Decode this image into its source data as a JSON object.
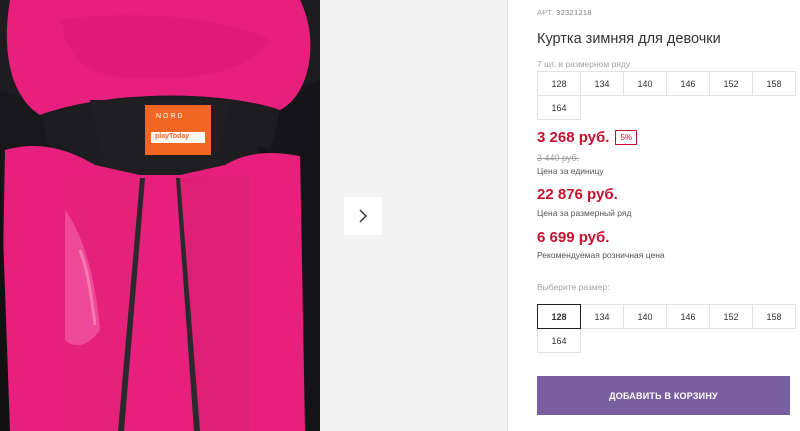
{
  "gallery": {
    "brand_label_top": "NORD",
    "brand_label_logo": "playToday",
    "next_icon": "chevron-right-icon"
  },
  "product": {
    "sku_label": "АРТ.",
    "sku": "32321218",
    "title": "Куртка зимняя для девочки",
    "size_count": "7 шт. в размерном ряду",
    "sizes_row": [
      "128",
      "134",
      "140",
      "146",
      "152",
      "158",
      "164"
    ],
    "price": "3 268 руб.",
    "discount": "5%",
    "old_price": "3 440 руб.",
    "price_note": "Цена за единицу",
    "set_price": "22 876 руб.",
    "set_price_note": "Цена за размерный ряд",
    "retail_price": "6 699 руб.",
    "retail_price_note": "Рекомендуемая розничная цена",
    "choose_size_label": "Выберите размер:",
    "size_options": [
      "128",
      "134",
      "140",
      "146",
      "152",
      "158",
      "164"
    ],
    "selected_size": "128",
    "add_to_cart": "ДОБАВИТЬ В КОРЗИНУ"
  },
  "colors": {
    "accent_price": "#c8102e",
    "button": "#7a5fa0",
    "jacket_pink": "#e8207d",
    "jacket_black": "#1d1d1f",
    "label_orange": "#f26522"
  }
}
